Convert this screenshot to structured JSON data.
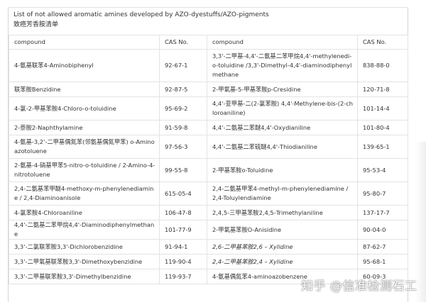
{
  "header": {
    "title_en": "List of not allowed aromatic amines developed by AZO-dyestuffs/AZO-pigments",
    "title_cn": "致癌芳香胺清单"
  },
  "table": {
    "columns": [
      "compound",
      "CAS No.",
      "compound",
      "CAS No."
    ],
    "rows": [
      {
        "h": "triple",
        "c1": "4-氨基联苯4-Aminobiphenyl",
        "c2": "92-67-1",
        "c3": "3,3'-二甲基-4,4'-二氨基二苯甲烷4,4'-methylenedi-o-toluidine /3,3'-Dimethyl-4,4'-diaminodiphenylmethane",
        "c4": "838-88-0"
      },
      {
        "h": "single",
        "c1": "联苯胺Benzidine",
        "c2": "92-87-5",
        "c3": "2-甲氧基-5-甲基苯胺p-Cresidine",
        "c4": "120-71-8"
      },
      {
        "h": "double",
        "c1": "4-氯-2-甲基苯胺4-Chloro-o-toluidine",
        "c2": "95-69-2",
        "c3": "4,4'-亚甲基-二(2-氯苯胺) 4,4'-Methylene-bis-(2-chloroaniline)",
        "c4": "101-14-4"
      },
      {
        "h": "single",
        "c1": "2-萘胺2-Naphthylamine",
        "c2": "91-59-8",
        "c3": "4,4'-二氨基二苯醚4,4'-Oxydianiline",
        "c4": "101-80-4"
      },
      {
        "h": "double",
        "c1": "4-氨基-3,2'-二甲基偶氮苯(邻氨基偶氮甲苯) o-Aminoazotoluene",
        "c2": "97-56-3",
        "c3": "4,4'-二氨基二苯硫醚4,4'-Thiodianiline",
        "c4": "139-65-1"
      },
      {
        "h": "double",
        "c1": "2-氨基-4-硝基甲苯5-nitro-o-toluidine / 2-Amino-4-nitrotoluene",
        "c2": "99-55-8",
        "c3": "2-甲基苯胺o-Toluidine",
        "c4": "95-53-4"
      },
      {
        "h": "double",
        "c1": "2,4-二氨基苯甲醚4-methoxy-m-phenylenediamine / 2,4-Diaminoanisole",
        "c2": "615-05-4",
        "c3": "2,4-二氨基甲苯4-methyl-m-phenylenediamine /2,4-Toluylendiamine",
        "c4": "95-80-7"
      },
      {
        "h": "single",
        "c1": "4-氯苯胺4-Chloroaniline",
        "c2": "106-47-8",
        "c3": "2,4,5-三甲基苯胺2,4,5-Trimethylaniline",
        "c4": "137-17-7"
      },
      {
        "h": "single",
        "c1": "4,4'-二氨基二苯甲烷4,4'-Diaminodiphenylmethane",
        "c2": "101-77-9",
        "c3": "2-甲氧基苯胺O-Anisidine",
        "c4": "90-04-0"
      },
      {
        "h": "single",
        "c1": "3,3'-二氯联苯胺3,3'-Dichlorobenzidine",
        "c2": "91-94-1",
        "c3": "2,6-二甲基苯胺2,6 – Xylidine",
        "c4": "87-62-7",
        "c3_italic": true
      },
      {
        "h": "single",
        "c1": "3,3'-二甲氧基联苯胺3,3'-Dimethoxybenzidine",
        "c2": "119-90-4",
        "c3": "2,4-二甲基苯胺2,4 – Xylidine",
        "c4": "95-68-1",
        "c3_italic": true
      },
      {
        "h": "single",
        "c1": "3,3'-二甲基联苯胺3,3'-Dimethylbenzidine",
        "c2": "119-93-7",
        "c3": "4-氨基偶氮苯4-aminoazobenzene",
        "c4": "60-09-3"
      }
    ]
  },
  "watermark": "知乎 @信准检测石工"
}
